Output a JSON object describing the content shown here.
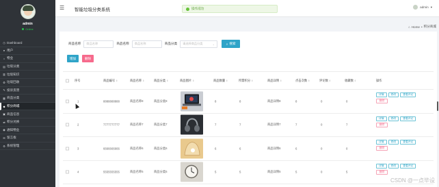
{
  "sidebar": {
    "user_name": "admin",
    "user_status": "Online",
    "items": [
      {
        "label": "Dashboard",
        "icon": "dashboard-icon",
        "active": false
      },
      {
        "label": "用户",
        "icon": "user-icon",
        "active": false
      },
      {
        "label": "物业",
        "icon": "home-icon",
        "active": false
      },
      {
        "label": "垃圾分类",
        "icon": "list-icon",
        "active": false
      },
      {
        "label": "垃圾知识",
        "icon": "book-icon",
        "active": false
      },
      {
        "label": "垃圾回收",
        "icon": "recycle-icon",
        "active": false
      },
      {
        "label": "投诉反馈",
        "icon": "feedback-icon",
        "active": false
      },
      {
        "label": "商品分类",
        "icon": "grid-icon",
        "active": false
      },
      {
        "label": "积分商城",
        "icon": "shop-icon",
        "active": true
      },
      {
        "label": "商品信息",
        "icon": "tag-icon",
        "active": false
      },
      {
        "label": "积分兑换",
        "icon": "exchange-icon",
        "active": false
      },
      {
        "label": "通知物业",
        "icon": "bell-icon",
        "active": false
      },
      {
        "label": "留言板",
        "icon": "message-icon",
        "active": false
      },
      {
        "label": "系统管理",
        "icon": "settings-icon",
        "active": false
      }
    ]
  },
  "topbar": {
    "title": "智能垃圾分类系统",
    "toast": "操作成功",
    "user_label": "admin"
  },
  "breadcrumb": {
    "home": "Home",
    "separator": "•",
    "current": "积分商城"
  },
  "filters": {
    "f1_label": "商品名称",
    "f1_placeholder": "商品名称",
    "f2_label": "商品名称",
    "f2_placeholder": "商品名称",
    "f3_label": "商品分类",
    "f3_placeholder": "请选择商品分类",
    "search_label": "搜索"
  },
  "actions": {
    "add": "增加",
    "delete": "删除"
  },
  "table": {
    "headers": [
      "序号",
      "商品编号",
      "商品名称",
      "商品分类",
      "商品图片",
      "商品数量",
      "所需积分",
      "商品详情",
      "点击次数",
      "评论数",
      "收藏数",
      "操作"
    ],
    "rows": [
      {
        "index": "1",
        "code": "8888888888",
        "name": "商品名称8",
        "category": "商品分类8",
        "qty": "8",
        "points": "8",
        "detail": "商品详情8",
        "clicks": "8",
        "comments": "0",
        "favorites": "0",
        "img": "laptop"
      },
      {
        "index": "2",
        "code": "7777777777",
        "name": "商品名称7",
        "category": "商品分类7",
        "qty": "7",
        "points": "7",
        "detail": "商品详情7",
        "clicks": "7",
        "comments": "0",
        "favorites": "7",
        "img": "headphones"
      },
      {
        "index": "3",
        "code": "6666666666",
        "name": "商品名称6",
        "category": "商品分类6",
        "qty": "6",
        "points": "6",
        "detail": "商品详情6",
        "clicks": "6",
        "comments": "0",
        "favorites": "0",
        "img": "shell"
      },
      {
        "index": "4",
        "code": "5555555555",
        "name": "商品名称5",
        "category": "商品分类5",
        "qty": "5",
        "points": "5",
        "detail": "商品详情5",
        "clicks": "5",
        "comments": "0",
        "favorites": "5",
        "img": "clock"
      }
    ],
    "op_detail": "详情",
    "op_edit": "修改",
    "op_comment": "查看评论",
    "op_delete": "删除"
  },
  "watermark": "CSDN @一点毕设",
  "colors": {
    "sidebar_bg": "#2f3338",
    "primary": "#2fa4c8",
    "danger": "#f66a8c",
    "success": "#67c23a"
  }
}
